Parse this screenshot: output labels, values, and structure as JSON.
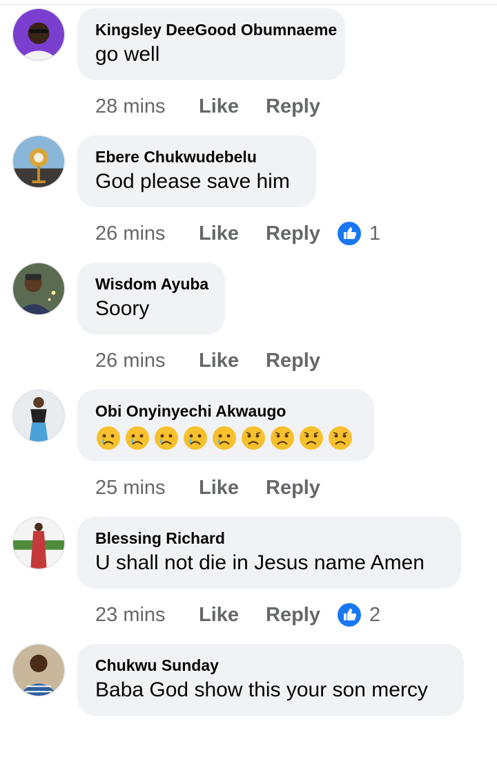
{
  "accent_color": "#1877f2",
  "like_label": "Like",
  "reply_label": "Reply",
  "comments": [
    {
      "author": "Kingsley DeeGood Obumnaeme",
      "text": "go well",
      "time": "28 mins",
      "reactions": null
    },
    {
      "author": "Ebere Chukwudebelu",
      "text": "God please save him",
      "time": "26 mins",
      "reactions": "1"
    },
    {
      "author": "Wisdom Ayuba",
      "text": "Soory",
      "time": "26 mins",
      "reactions": null
    },
    {
      "author": "Obi Onyinyechi Akwaugo",
      "text": "",
      "emojis": [
        "crying-face",
        "crying-face",
        "crying-face",
        "crying-face",
        "crying-face",
        "worried-face",
        "worried-face",
        "worried-face",
        "worried-face"
      ],
      "time": "25 mins",
      "reactions": null
    },
    {
      "author": "Blessing Richard",
      "text": "U shall not die in Jesus name Amen",
      "time": "23 mins",
      "reactions": "2"
    },
    {
      "author": "Chukwu Sunday",
      "text": "Baba God show this your son mercy",
      "time": "",
      "reactions": null
    }
  ]
}
